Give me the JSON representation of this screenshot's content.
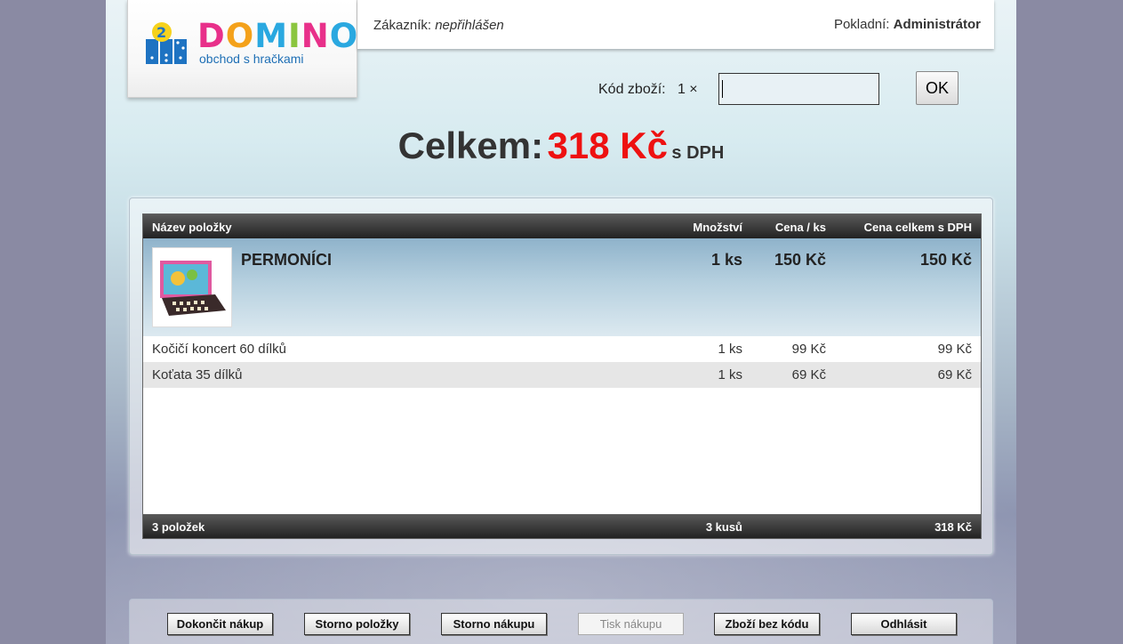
{
  "logo": {
    "title_letters": [
      "D",
      "O",
      "M",
      "I",
      "N",
      "O"
    ],
    "subtitle": "obchod s hračkami"
  },
  "header": {
    "customer_label": "Zákazník:",
    "customer_value": "nepřihlášen",
    "cashier_label": "Pokladní:",
    "cashier_value": "Administrátor"
  },
  "entry": {
    "label": "Kód zboží:   1 ×",
    "value": "",
    "ok_label": "OK"
  },
  "total": {
    "label": "Celkem:",
    "amount": "318 Kč",
    "suffix": "s DPH"
  },
  "table": {
    "headers": {
      "name": "Název položky",
      "qty": "Množství",
      "unit": "Cena / ks",
      "total": "Cena celkem s DPH"
    },
    "highlighted": {
      "name": "PERMONÍCI",
      "qty": "1 ks",
      "unit": "150 Kč",
      "total": "150 Kč"
    },
    "rows": [
      {
        "name": "Kočičí koncert 60 dílků",
        "qty": "1 ks",
        "unit": "99 Kč",
        "total": "99 Kč"
      },
      {
        "name": "Koťata 35 dílků",
        "qty": "1 ks",
        "unit": "69 Kč",
        "total": "69 Kč"
      }
    ],
    "footer": {
      "count": "3 položek",
      "qty": "3 kusů",
      "total": "318 Kč"
    }
  },
  "actions": {
    "finish": "Dokončit nákup",
    "cancel_item": "Storno položky",
    "cancel_purchase": "Storno nákupu",
    "print": "Tisk nákupu",
    "no_code": "Zboží bez kódu",
    "logout": "Odhlásit"
  }
}
